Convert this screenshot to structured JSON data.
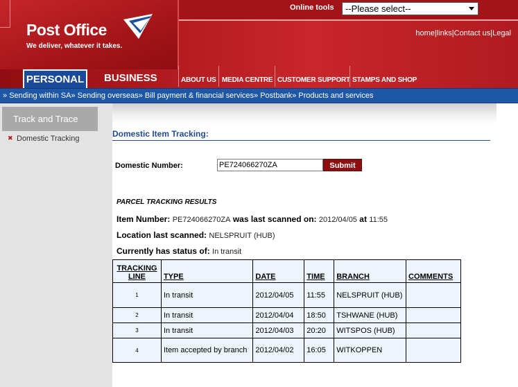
{
  "header": {
    "logo_text": "Post Office",
    "tagline": "We deliver, whatever it takes.",
    "online_tools_label": "Online tools",
    "online_tools_select": "--Please select--",
    "util_links": [
      "home",
      "links",
      "Contact us",
      "Legal"
    ],
    "tab_personal": "PERSONAL",
    "tab_business": "BUSINESS",
    "nav_items": [
      "ABOUT US",
      "MEDIA CENTRE",
      "CUSTOMER SUPPORT",
      "STAMPS AND SHOP"
    ]
  },
  "subnav": {
    "items": [
      "Sending within SA",
      "Sending overseas",
      "Bill payment & financial services",
      "Postbank",
      "Products and services"
    ]
  },
  "sidebar": {
    "heading": "Track and Trace",
    "items": [
      "Domestic Tracking"
    ]
  },
  "main": {
    "title": "Domestic Item Tracking:",
    "number_label": "Domestic Number:",
    "number_value": "PE724066270ZA",
    "submit_label": "Submit",
    "results_title": "PARCEL TRACKING RESULTS",
    "item_number_label": "Item Number:",
    "item_number_value": "PE724066270ZA",
    "last_scanned_label": "was last scanned on:",
    "last_scanned_date": "2012/04/05",
    "at_label": "at",
    "last_scanned_time": "11:55",
    "location_label": "Location last scanned:",
    "location_value": "NELSPRUIT (HUB)",
    "status_label": "Currently has status of:",
    "status_value": "In transit"
  },
  "table": {
    "headers": [
      "TRACKING LINE",
      "TYPE",
      "DATE",
      "TIME",
      "BRANCH",
      "COMMENTS"
    ],
    "rows": [
      {
        "line": "1",
        "type": "In transit",
        "date": "2012/04/05",
        "time": "11:55",
        "branch": "NELSPRUIT (HUB)",
        "comments": ""
      },
      {
        "line": "2",
        "type": "In transit",
        "date": "2012/04/04",
        "time": "18:50",
        "branch": "TSHWANE (HUB)",
        "comments": ""
      },
      {
        "line": "3",
        "type": "In transit",
        "date": "2012/04/03",
        "time": "20:20",
        "branch": "WITSPOS (HUB)",
        "comments": ""
      },
      {
        "line": "4",
        "type": "Item accepted by branch",
        "date": "2012/04/02",
        "time": "16:05",
        "branch": "WITKOPPEN",
        "comments": ""
      }
    ]
  },
  "colors": {
    "brand_red": "#a31317",
    "nav_blue": "#1e57a6",
    "title_blue": "#1f4b8f",
    "submit_red": "#8e0f12"
  }
}
